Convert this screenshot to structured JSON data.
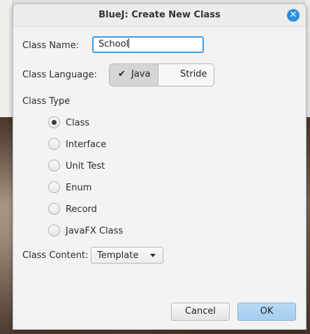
{
  "window": {
    "title": "BlueJ:  Create New Class",
    "close_icon": "close-icon"
  },
  "form": {
    "class_name_label": "Class Name:",
    "class_name_value": "School",
    "class_language_label": "Class Language:",
    "languages": [
      {
        "label": "Java",
        "selected": true
      },
      {
        "label": "Stride",
        "selected": false
      }
    ],
    "class_type_label": "Class Type",
    "class_types": [
      {
        "label": "Class",
        "selected": true
      },
      {
        "label": "Interface",
        "selected": false
      },
      {
        "label": "Unit Test",
        "selected": false
      },
      {
        "label": "Enum",
        "selected": false
      },
      {
        "label": "Record",
        "selected": false
      },
      {
        "label": "JavaFX Class",
        "selected": false
      }
    ],
    "class_content_label": "Class Content:",
    "class_content_value": "Template"
  },
  "buttons": {
    "cancel": "Cancel",
    "ok": "OK"
  },
  "colors": {
    "accent": "#2d8fdd",
    "focus_border": "#3c9ae8",
    "ok_button": "#a5cdef"
  }
}
